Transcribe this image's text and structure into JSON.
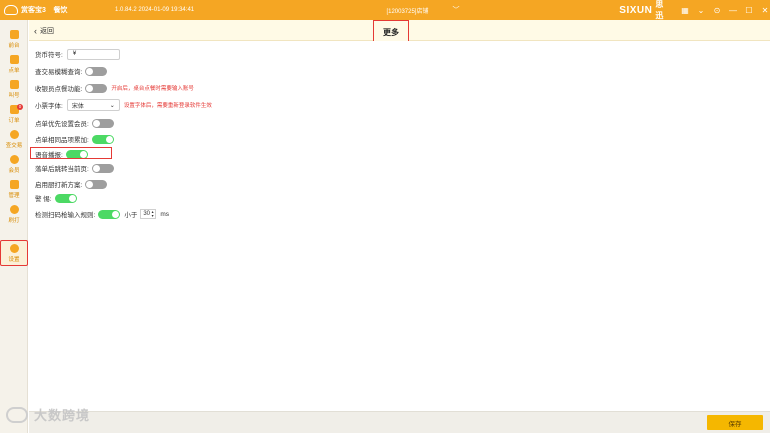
{
  "titlebar": {
    "app_name": "赏客宝3",
    "mode": "餐饮",
    "version_time": "1.0.84.2  2024-01-09 19:34:41",
    "store": "[12003725]店铺",
    "brand_en": "SIXUN",
    "brand_cn": "思迅"
  },
  "sidebar": {
    "items": [
      {
        "label": "前台"
      },
      {
        "label": "点单"
      },
      {
        "label": "叫号"
      },
      {
        "label": "订单",
        "badge": "0"
      },
      {
        "label": "查交易"
      },
      {
        "label": "会员"
      },
      {
        "label": "管理"
      },
      {
        "label": "刷打"
      },
      {
        "label": "设置"
      }
    ]
  },
  "header": {
    "back_label": "返回",
    "title": "更多"
  },
  "settings": {
    "currency": {
      "label": "货币符号:",
      "value": "¥"
    },
    "fuzzy_query": {
      "label": "查交易模糊查询:"
    },
    "cashier_order": {
      "label": "收银员点餐功能:",
      "hint": "开启后，桌台点餐时需要输入账号"
    },
    "receipt_font": {
      "label": "小票字体:",
      "value": "宋体",
      "hint": "设置字体后，需要重新登录软件生效"
    },
    "member_first": {
      "label": "点单优先设置会员:"
    },
    "merge_items": {
      "label": "点单相同品项累加:"
    },
    "voice_broadcast": {
      "label": "语音播报:"
    },
    "jump_after_order": {
      "label": "落单后跳转当前页:"
    },
    "kitchen_print": {
      "label": "启用厨打新方案:"
    },
    "warning": {
      "label": "警  惕:"
    },
    "scan_rule": {
      "label": "检测扫码枪输入规则:",
      "less_than": "小于",
      "value": "30",
      "unit": "ms"
    }
  },
  "footer": {
    "save_label": "保存",
    "watermark": "大数跨境"
  }
}
